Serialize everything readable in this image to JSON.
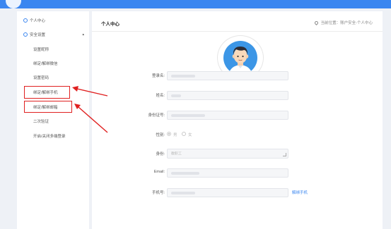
{
  "sidebar": {
    "personal_center": "个人中心",
    "security_settings": "安全设置",
    "sub_items": [
      "设置昵称",
      "绑定/解绑微信",
      "设置密码",
      "绑定/解绑手机",
      "绑定/解绑邮箱",
      "二次验证",
      "开启/关闭多端登录"
    ]
  },
  "main": {
    "title": "个人中心",
    "breadcrumb": "当前位置：账户安全-个人中心"
  },
  "form": {
    "username_label": "登录名:",
    "name_label": "姓名:",
    "id_label": "身份证号:",
    "gender_label": "性别:",
    "gender_male": "男",
    "gender_female": "女",
    "identity_label": "身份:",
    "identity_value": "教职工",
    "email_label": "Email:",
    "phone_label": "手机号:",
    "unbind_phone": "解绑手机"
  },
  "colors": {
    "accent": "#3a86f0",
    "highlight": "#e02020"
  }
}
